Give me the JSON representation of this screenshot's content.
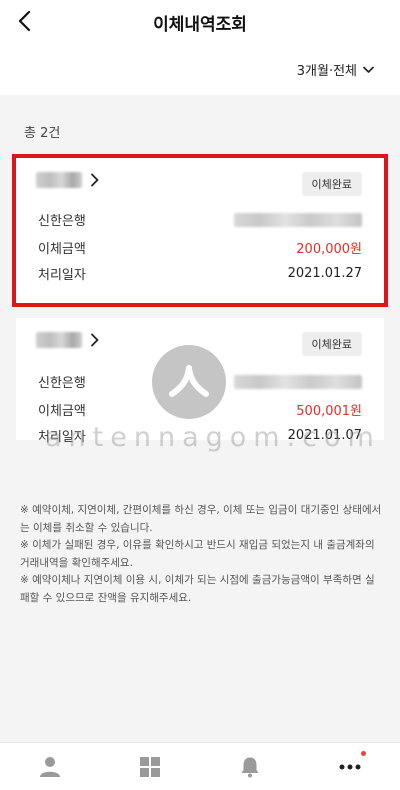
{
  "header": {
    "title": "이체내역조회",
    "back_icon": "chevron-left-icon",
    "period_filter": "3개월·전체",
    "period_icon": "chevron-down-icon"
  },
  "summary": {
    "total_label": "총 2건"
  },
  "transfers": [
    {
      "status": "이체완료",
      "bank_label": "신한은행",
      "amount_label": "이체금액",
      "amount": "200,000원",
      "date_label": "처리일자",
      "date": "2021.01.27"
    },
    {
      "status": "이체완료",
      "bank_label": "신한은행",
      "amount_label": "이체금액",
      "amount": "500,001원",
      "date_label": "처리일자",
      "date": "2021.01.07"
    }
  ],
  "watermark": {
    "text": "antennagom.com"
  },
  "notice": [
    "※ 예약이체, 지연이체, 간편이체를 하신 경우, 이체 또는 입금이 대기중인 상태에서는 이체를 취소할 수 있습니다.",
    "※ 이체가 실패된 경우, 이유를 확인하시고 반드시 재입금 되었는지 내 출금계좌의 거래내역을 확인해주세요.",
    "※ 예약이체나 지연이체 이용 시, 이체가 되는 시점에 출금가능금액이 부족하면 실패할 수 있으므로 잔액을 유지해주세요."
  ],
  "tabbar": {
    "items": [
      "person-icon",
      "grid-icon",
      "bell-icon",
      "more-icon"
    ]
  },
  "colors": {
    "accent": "#e0302a",
    "highlight_border": "#e0141b",
    "badge_dot": "#e8453c"
  }
}
